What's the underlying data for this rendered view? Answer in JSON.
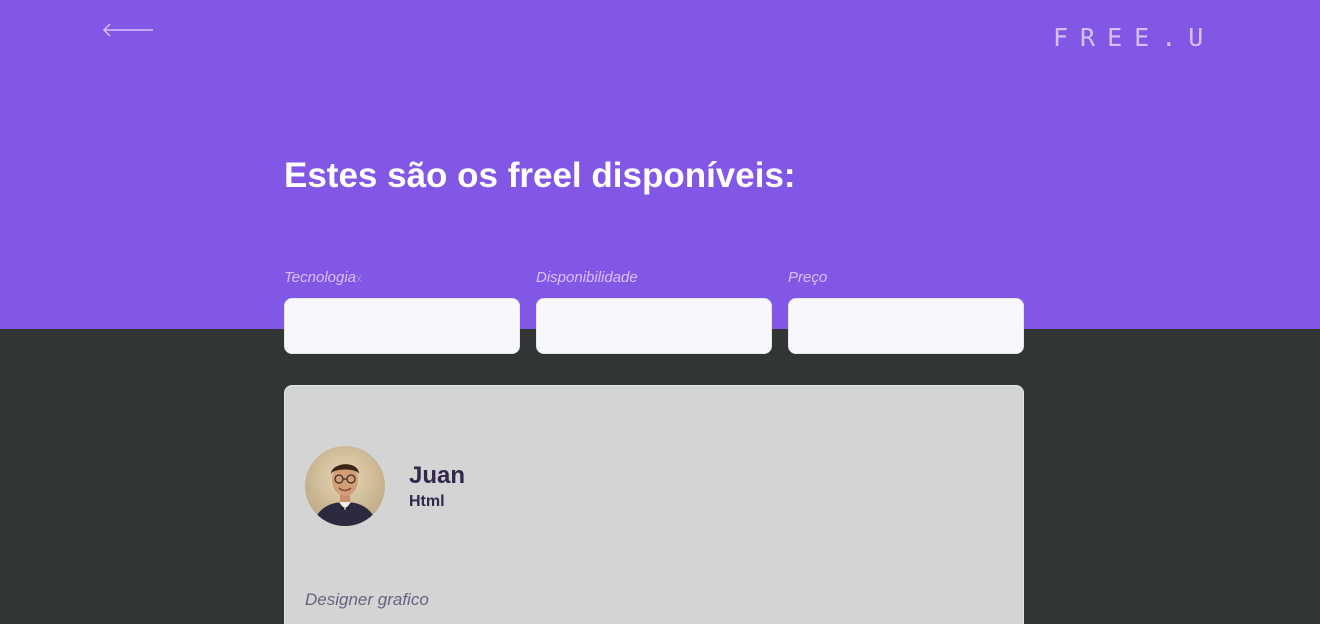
{
  "header": {
    "back_icon": "arrow-left-icon",
    "logo": "FREE.U"
  },
  "page": {
    "title": "Estes são os freel disponíveis:"
  },
  "filters": [
    {
      "label": "Tecnologia",
      "mark": "x",
      "value": ""
    },
    {
      "label": "Disponibilidade",
      "value": ""
    },
    {
      "label": "Preço",
      "value": ""
    }
  ],
  "card": {
    "name": "Juan",
    "subject": "Html",
    "bio": "Designer grafico",
    "avatar_icon": "avatar-photo"
  },
  "colors": {
    "primary": "#8257e5",
    "background": "#313533",
    "card": "#d3d5d4",
    "input": "#f8f8fc",
    "title_text": "#32264d",
    "label_text": "#d4c2ff"
  }
}
